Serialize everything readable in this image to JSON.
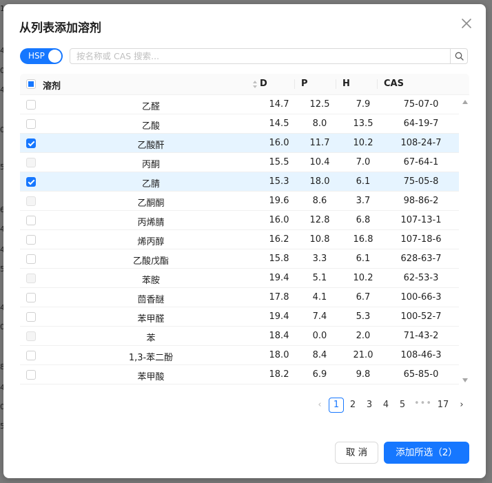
{
  "backdrop": {
    "edge_digits": [
      "1",
      "4",
      "0",
      "4",
      "0",
      "5",
      "6",
      "4",
      "4",
      "5",
      "4",
      "0",
      "8",
      "4",
      "0",
      "5"
    ]
  },
  "dialog": {
    "title": "从列表添加溶剂",
    "close_icon": "close-icon"
  },
  "toolbar": {
    "hsp_toggle_label": "HSP",
    "hsp_toggle_on": true,
    "search_placeholder": "按名称或 CAS 搜索...",
    "search_value": ""
  },
  "table": {
    "columns": {
      "name": "溶剂",
      "d": "D",
      "p": "P",
      "h": "H",
      "cas": "CAS"
    },
    "header_checkbox_state": "indeterminate",
    "rows": [
      {
        "name": "乙醛",
        "d": "14.7",
        "p": "12.5",
        "h": "7.9",
        "cas": "75-07-0",
        "state": "unchecked"
      },
      {
        "name": "乙酸",
        "d": "14.5",
        "p": "8.0",
        "h": "13.5",
        "cas": "64-19-7",
        "state": "unchecked"
      },
      {
        "name": "乙酸酐",
        "d": "16.0",
        "p": "11.7",
        "h": "10.2",
        "cas": "108-24-7",
        "state": "checked"
      },
      {
        "name": "丙酮",
        "d": "15.5",
        "p": "10.4",
        "h": "7.0",
        "cas": "67-64-1",
        "state": "disabled"
      },
      {
        "name": "乙腈",
        "d": "15.3",
        "p": "18.0",
        "h": "6.1",
        "cas": "75-05-8",
        "state": "checked"
      },
      {
        "name": "乙酮酮",
        "d": "19.6",
        "p": "8.6",
        "h": "3.7",
        "cas": "98-86-2",
        "state": "disabled"
      },
      {
        "name": "丙烯腈",
        "d": "16.0",
        "p": "12.8",
        "h": "6.8",
        "cas": "107-13-1",
        "state": "unchecked"
      },
      {
        "name": "烯丙醇",
        "d": "16.2",
        "p": "10.8",
        "h": "16.8",
        "cas": "107-18-6",
        "state": "unchecked"
      },
      {
        "name": "乙酸戊酯",
        "d": "15.8",
        "p": "3.3",
        "h": "6.1",
        "cas": "628-63-7",
        "state": "unchecked"
      },
      {
        "name": "苯胺",
        "d": "19.4",
        "p": "5.1",
        "h": "10.2",
        "cas": "62-53-3",
        "state": "disabled"
      },
      {
        "name": "茴香醚",
        "d": "17.8",
        "p": "4.1",
        "h": "6.7",
        "cas": "100-66-3",
        "state": "unchecked"
      },
      {
        "name": "苯甲醛",
        "d": "19.4",
        "p": "7.4",
        "h": "5.3",
        "cas": "100-52-7",
        "state": "unchecked"
      },
      {
        "name": "苯",
        "d": "18.4",
        "p": "0.0",
        "h": "2.0",
        "cas": "71-43-2",
        "state": "disabled"
      },
      {
        "name": "1,3-苯二酚",
        "d": "18.0",
        "p": "8.4",
        "h": "21.0",
        "cas": "108-46-3",
        "state": "unchecked"
      },
      {
        "name": "苯甲酸",
        "d": "18.2",
        "p": "6.9",
        "h": "9.8",
        "cas": "65-85-0",
        "state": "unchecked"
      }
    ]
  },
  "pagination": {
    "prev": "‹",
    "pages": [
      "1",
      "2",
      "3",
      "4",
      "5"
    ],
    "current": "1",
    "ellipsis": "•••",
    "last": "17",
    "next": "›"
  },
  "footer": {
    "cancel_label": "取 消",
    "add_label": "添加所选（2）"
  },
  "colors": {
    "primary": "#1677ff",
    "selected_row": "#e6f4ff"
  }
}
